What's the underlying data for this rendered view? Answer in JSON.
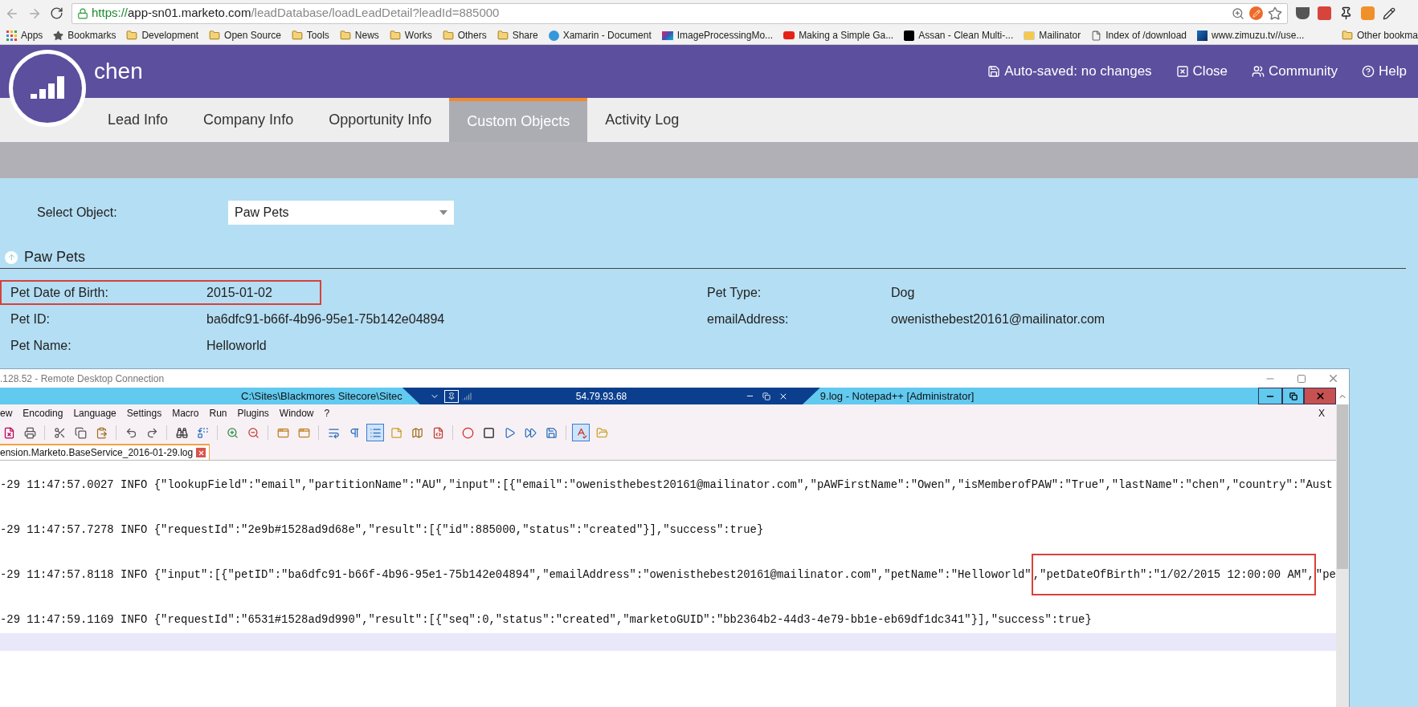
{
  "browser": {
    "url_scheme": "https://",
    "url_host": "app-sn01.marketo.com",
    "url_path": "/leadDatabase/loadLeadDetail?leadId=885000",
    "bookmarks": [
      {
        "label": "Apps",
        "kind": "apps"
      },
      {
        "label": "Bookmarks",
        "kind": "star"
      },
      {
        "label": "Development",
        "kind": "folder"
      },
      {
        "label": "Open Source",
        "kind": "folder"
      },
      {
        "label": "Tools",
        "kind": "folder"
      },
      {
        "label": "News",
        "kind": "folder"
      },
      {
        "label": "Works",
        "kind": "folder"
      },
      {
        "label": "Others",
        "kind": "folder"
      },
      {
        "label": "Share",
        "kind": "folder"
      },
      {
        "label": "Xamarin - Document",
        "kind": "xamarin"
      },
      {
        "label": "ImageProcessingMo...",
        "kind": "image"
      },
      {
        "label": "Making a Simple Ga...",
        "kind": "video"
      },
      {
        "label": "Assan - Clean Multi-...",
        "kind": "wlogo"
      },
      {
        "label": "Mailinator",
        "kind": "mail"
      },
      {
        "label": "Index of /download",
        "kind": "page"
      },
      {
        "label": "www.zimuzu.tv//use...",
        "kind": "zimuzu"
      }
    ],
    "other_bookmarks": "Other bookma"
  },
  "header": {
    "title": "chen",
    "actions": [
      {
        "label": "Auto-saved: no changes",
        "kind": "save"
      },
      {
        "label": "Close",
        "kind": "close"
      },
      {
        "label": "Community",
        "kind": "community"
      },
      {
        "label": "Help",
        "kind": "help"
      }
    ]
  },
  "tabs": [
    {
      "label": "Lead Info",
      "selected": false
    },
    {
      "label": "Company Info",
      "selected": false
    },
    {
      "label": "Opportunity Info",
      "selected": false
    },
    {
      "label": "Custom Objects",
      "selected": true
    },
    {
      "label": "Activity Log",
      "selected": false
    }
  ],
  "select_object": {
    "label": "Select Object:",
    "value": "Paw Pets"
  },
  "section": {
    "title": "Paw Pets",
    "fields": [
      {
        "label": "Pet Date of Birth:",
        "value": "2015-01-02",
        "highlighted": true
      },
      {
        "label": "Pet Type:",
        "value": "Dog",
        "highlighted": false
      },
      {
        "label": "Pet ID:",
        "value": "ba6dfc91-b66f-4b96-95e1-75b142e04894",
        "highlighted": false
      },
      {
        "label": "emailAddress:",
        "value": "owenisthebest20161@mailinator.com",
        "highlighted": false
      },
      {
        "label": "Pet Name:",
        "value": "Helloworld",
        "highlighted": false
      }
    ]
  },
  "remote_desktop": {
    "title": ".128.52 - Remote Desktop Connection",
    "host": "54.79.93.68"
  },
  "notepad": {
    "title_before": "C:\\Sites\\Blackmores Sitecore\\Sitec",
    "title_after": "9.log - Notepad++ [Administrator]",
    "menu": [
      "ew",
      "Encoding",
      "Language",
      "Settings",
      "Macro",
      "Run",
      "Plugins",
      "Window",
      "?"
    ],
    "close_label": "X",
    "toolbar": [
      {
        "pressed": false
      },
      {
        "pressed": false
      },
      {
        "pressed": false
      },
      {
        "pressed": false
      },
      {
        "pressed": false
      },
      {
        "pressed": false
      },
      {
        "pressed": false
      },
      {
        "pressed": false
      },
      {
        "pressed": false
      },
      {
        "pressed": false
      },
      {
        "pressed": false
      },
      {
        "pressed": false
      },
      {
        "pressed": false
      },
      {
        "pressed": false
      },
      {
        "pressed": false
      },
      {
        "pressed": true
      },
      {
        "pressed": false
      },
      {
        "pressed": false
      },
      {
        "pressed": false
      },
      {
        "pressed": false
      },
      {
        "pressed": false
      },
      {
        "pressed": false
      },
      {
        "pressed": false
      },
      {
        "pressed": false
      },
      {
        "pressed": true
      },
      {
        "pressed": false
      }
    ],
    "tab": {
      "label": "ension.Marketo.BaseService_2016-01-29.log"
    },
    "log_lines": [
      {
        "segments": [
          {
            "text": "-29 11:47:57.0027 INFO {\"lookupField\":\"email\",\"partitionName\":\"AU\",\"input\":[{\"email\":\"owenisthebest20161@mailinator.com\",\"pAWFirstName\":\"Owen\",\"isMemberofPAW\":\"True\",\"lastName\":\"chen\",\"country\":\"Aust",
            "highlighted": false
          }
        ]
      },
      {
        "segments": [
          {
            "text": "-29 11:47:57.7278 INFO {\"requestId\":\"2e9b#1528ad9d68e\",\"result\":[{\"id\":885000,\"status\":\"created\"}],\"success\":true}",
            "highlighted": false
          }
        ]
      },
      {
        "segments": [
          {
            "text": "-29 11:47:57.8118 INFO {\"input\":[{\"petID\":\"ba6dfc91-b66f-4b96-95e1-75b142e04894\",\"emailAddress\":\"owenisthebest20161@mailinator.com\",\"petName\":\"Helloworld\"",
            "highlighted": false
          },
          {
            "text": ",\"petDateOfBirth\":\"1/02/2015 12:00:00 AM\",",
            "highlighted": true
          },
          {
            "text": "\"pe",
            "highlighted": false
          }
        ]
      },
      {
        "segments": [
          {
            "text": "-29 11:47:59.1169 INFO {\"requestId\":\"6531#1528ad9d990\",\"result\":[{\"seq\":0,\"status\":\"created\",\"marketoGUID\":\"bb2364b2-44d3-4e79-bb1e-eb69df1dc341\"}],\"success\":true}",
            "highlighted": false
          }
        ]
      }
    ]
  }
}
